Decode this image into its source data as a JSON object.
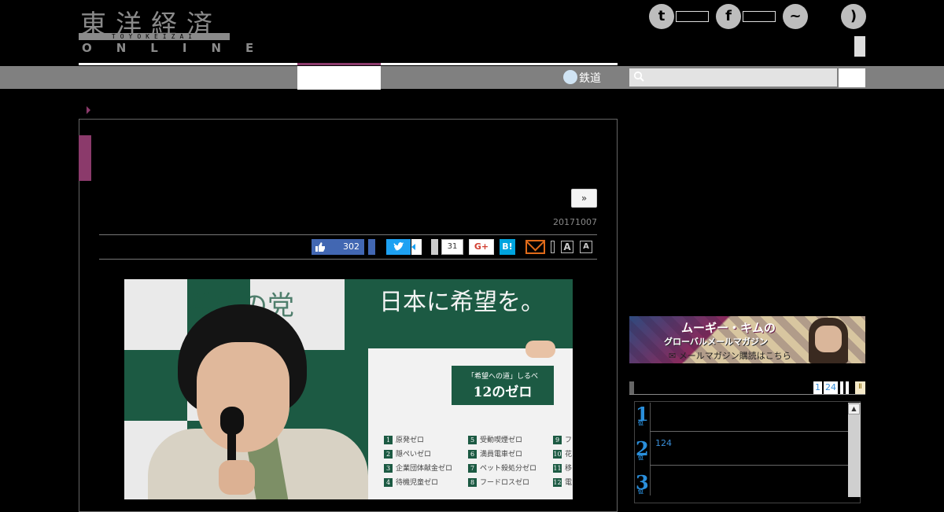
{
  "logo": {
    "kanji": "東洋経済",
    "romaji": "TOYOKEIZAI",
    "online": "ONLINE"
  },
  "header": {
    "social": [
      {
        "name": "twitter-icon",
        "glyph": "t"
      },
      {
        "name": "facebook-icon",
        "glyph": "f"
      },
      {
        "name": "messenger-icon",
        "glyph": "~"
      },
      {
        "name": "rss-icon",
        "glyph": ")"
      }
    ]
  },
  "nav": {
    "tetsudo_label": "鉄道",
    "search_icon": "search-icon"
  },
  "article": {
    "next_label": "»",
    "date": "20171007",
    "share": {
      "like_count": "302",
      "like_icon": "thumbs-up-icon",
      "twitter_icon": "twitter-icon",
      "comment_count": "31",
      "gplus_label": "G+",
      "hatena_label": "B!",
      "font_large": "A",
      "font_small": "A"
    },
    "photo": {
      "poster_text": "希望の党",
      "banner_text": "日本に希望を。",
      "board_subtitle": "「希望への道」しるべ",
      "board_title": "12のゼロ",
      "zero_items": [
        {
          "n": "1",
          "label": "原発ゼロ"
        },
        {
          "n": "2",
          "label": "隠ぺいゼロ"
        },
        {
          "n": "3",
          "label": "企業団体献金ゼロ"
        },
        {
          "n": "4",
          "label": "待機児童ゼロ"
        },
        {
          "n": "5",
          "label": "受動喫煙ゼロ"
        },
        {
          "n": "6",
          "label": "満員電車ゼロ"
        },
        {
          "n": "7",
          "label": "ペット殺処分ゼロ"
        },
        {
          "n": "8",
          "label": "フードロスゼロ"
        },
        {
          "n": "9",
          "label": "フ"
        },
        {
          "n": "10",
          "label": "花"
        },
        {
          "n": "11",
          "label": "移"
        },
        {
          "n": "12",
          "label": "電"
        }
      ]
    }
  },
  "sidebar": {
    "ad": {
      "title": "ムーギー・キムの",
      "subtitle": "グローバルメールマガジン",
      "cta": "メールマガジン購読はこちら"
    },
    "ranking": {
      "tabs": [
        "1",
        "24"
      ],
      "items": [
        {
          "rank": "1",
          "suffix": "位",
          "text": ""
        },
        {
          "rank": "2",
          "suffix": "位",
          "text": "124"
        },
        {
          "rank": "3",
          "suffix": "位",
          "text": ""
        }
      ]
    }
  }
}
